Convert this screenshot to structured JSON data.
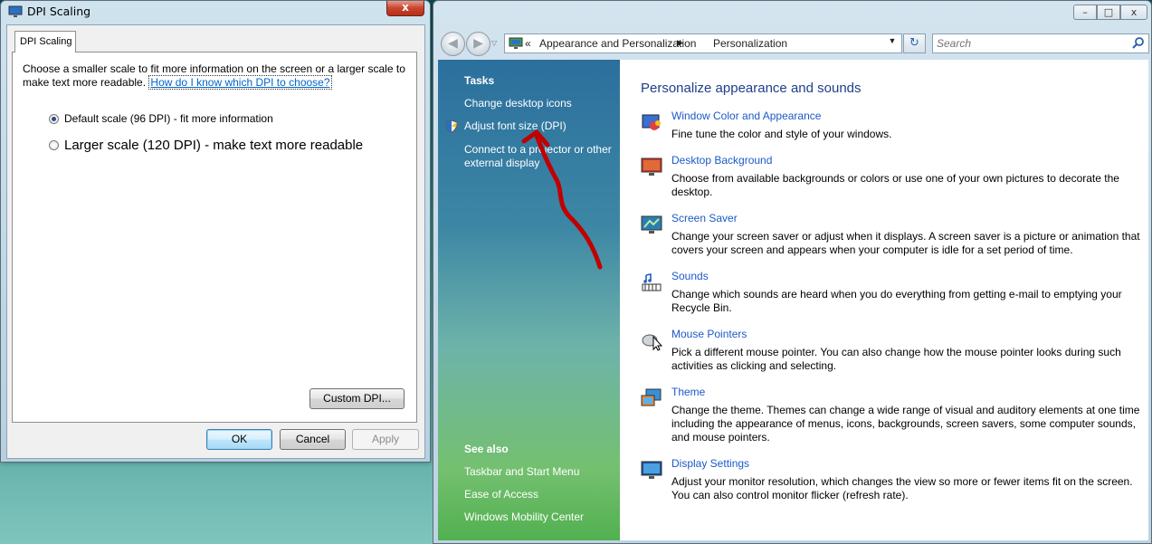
{
  "dpi_dialog": {
    "title": "DPI Scaling",
    "close_glyph": "x",
    "tab_label": "DPI Scaling",
    "description": "Choose a smaller scale to fit more information on the screen or a larger scale to make text more readable.",
    "help_link": "How do I know which DPI to choose?",
    "options": [
      {
        "label": "Default scale (96 DPI) - fit more information",
        "checked": true
      },
      {
        "label": "Larger scale (120 DPI) - make text more readable",
        "checked": false
      }
    ],
    "custom_button": "Custom DPI...",
    "ok_button": "OK",
    "cancel_button": "Cancel",
    "apply_button": "Apply"
  },
  "control_panel": {
    "caption_buttons": {
      "minimize": "–",
      "maximize": "□",
      "close": "x"
    },
    "nav": {
      "back_glyph": "◀",
      "forward_glyph": "▶",
      "dropdown_glyph": "▽"
    },
    "address": {
      "chevron": "«",
      "crumbs": [
        "Appearance and Personalization",
        "Personalization"
      ],
      "separator": "▶",
      "dropdown_glyph": "▼"
    },
    "refresh_glyph": "↻",
    "search_placeholder": "Search",
    "sidebar": {
      "tasks_heading": "Tasks",
      "tasks": [
        "Change desktop icons",
        "Adjust font size (DPI)",
        "Connect to a projector or other external display"
      ],
      "see_also_heading": "See also",
      "see_also": [
        "Taskbar and Start Menu",
        "Ease of Access",
        "Windows Mobility Center"
      ]
    },
    "main": {
      "heading": "Personalize appearance and sounds",
      "items": [
        {
          "title": "Window Color and Appearance",
          "desc": "Fine tune the color and style of your windows."
        },
        {
          "title": "Desktop Background",
          "desc": "Choose from available backgrounds or colors or use one of your own pictures to decorate the desktop."
        },
        {
          "title": "Screen Saver",
          "desc": "Change your screen saver or adjust when it displays. A screen saver is a picture or animation that covers your screen and appears when your computer is idle for a set period of time."
        },
        {
          "title": "Sounds",
          "desc": "Change which sounds are heard when you do everything from getting e-mail to emptying your Recycle Bin."
        },
        {
          "title": "Mouse Pointers",
          "desc": "Pick a different mouse pointer. You can also change how the mouse pointer looks during such activities as clicking and selecting."
        },
        {
          "title": "Theme",
          "desc": "Change the theme. Themes can change a wide range of visual and auditory elements at one time including the appearance of menus, icons, backgrounds, screen savers, some computer sounds, and mouse pointers."
        },
        {
          "title": "Display Settings",
          "desc": "Adjust your monitor resolution, which changes the view so more or fewer items fit on the screen. You can also control monitor flicker (refresh rate)."
        }
      ]
    }
  },
  "colors": {
    "link_blue": "#1c5ac8",
    "heading_blue": "#1e3e8a",
    "annotation_red": "#c00000"
  }
}
